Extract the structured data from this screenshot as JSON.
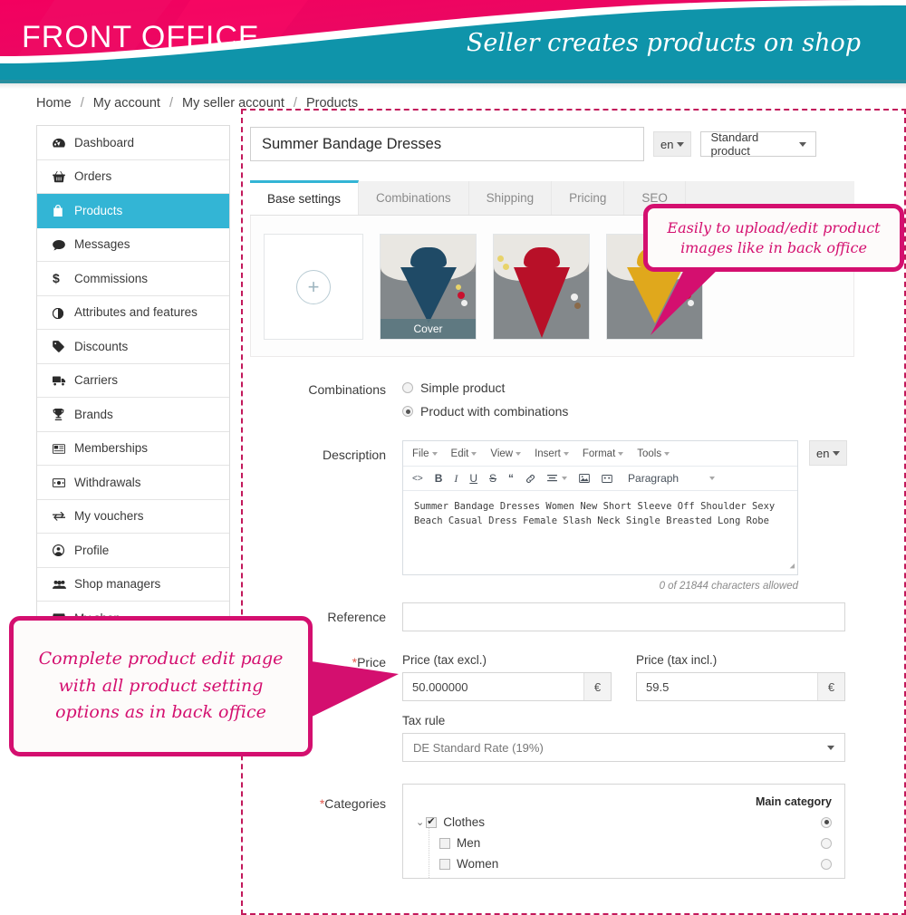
{
  "banner": {
    "left_title": "FRONT OFFICE",
    "right_title": "Seller creates products on shop",
    "pink": "#ec0a63",
    "teal": "#0f94aa"
  },
  "breadcrumb": {
    "items": [
      "Home",
      "My account",
      "My seller account",
      "Products"
    ],
    "separator": "/"
  },
  "sidebar": {
    "items": [
      {
        "label": "Dashboard",
        "icon": "dashboard-icon",
        "active": false
      },
      {
        "label": "Orders",
        "icon": "basket-icon",
        "active": false
      },
      {
        "label": "Products",
        "icon": "shopping-bag-icon",
        "active": true
      },
      {
        "label": "Messages",
        "icon": "comment-icon",
        "active": false
      },
      {
        "label": "Commissions",
        "icon": "dollar-icon",
        "active": false
      },
      {
        "label": "Attributes and features",
        "icon": "contrast-icon",
        "active": false
      },
      {
        "label": "Discounts",
        "icon": "tag-icon",
        "active": false
      },
      {
        "label": "Carriers",
        "icon": "truck-icon",
        "active": false
      },
      {
        "label": "Brands",
        "icon": "trophy-icon",
        "active": false
      },
      {
        "label": "Memberships",
        "icon": "id-card-icon",
        "active": false
      },
      {
        "label": "Withdrawals",
        "icon": "money-icon",
        "active": false
      },
      {
        "label": "My vouchers",
        "icon": "exchange-icon",
        "active": false
      },
      {
        "label": "Profile",
        "icon": "user-circle-icon",
        "active": false
      },
      {
        "label": "Shop managers",
        "icon": "users-icon",
        "active": false
      },
      {
        "label": "My shop",
        "icon": "store-icon",
        "active": false
      }
    ]
  },
  "product": {
    "name_value": "Summer Bandage Dresses",
    "lang_button": "en",
    "type_select": "Standard product"
  },
  "tabs": [
    {
      "label": "Base settings",
      "active": true
    },
    {
      "label": "Combinations",
      "active": false
    },
    {
      "label": "Shipping",
      "active": false
    },
    {
      "label": "Pricing",
      "active": false
    },
    {
      "label": "SEO",
      "active": false
    }
  ],
  "images": {
    "add_label": "+",
    "thumbs": [
      {
        "color": "#1f4a66",
        "cover": true,
        "cover_label": "Cover"
      },
      {
        "color": "#b81028",
        "cover": false,
        "cover_label": ""
      },
      {
        "color": "#e0a81c",
        "cover": false,
        "cover_label": ""
      }
    ]
  },
  "combinations": {
    "label": "Combinations",
    "options": [
      {
        "label": "Simple product",
        "checked": false
      },
      {
        "label": "Product with combinations",
        "checked": true
      }
    ]
  },
  "description": {
    "label": "Description",
    "lang_button": "en",
    "menu": [
      "File",
      "Edit",
      "View",
      "Insert",
      "Format",
      "Tools"
    ],
    "toolbar_icons": [
      "code-icon",
      "bold-icon",
      "italic-icon",
      "underline-icon",
      "strikethrough-icon",
      "blockquote-icon",
      "link-icon",
      "align-icon",
      "image-icon",
      "media-icon"
    ],
    "format_select": "Paragraph",
    "body_text": "Summer Bandage Dresses Women New Short Sleeve Off Shoulder Sexy Beach Casual Dress Female Slash Neck Single Breasted Long Robe",
    "char_count": "0 of 21844 characters allowed"
  },
  "reference": {
    "label": "Reference",
    "value": ""
  },
  "price": {
    "label": "Price",
    "required": "*",
    "tax_excl_caption": "Price (tax excl.)",
    "tax_excl_value": "50.000000",
    "tax_incl_caption": "Price (tax incl.)",
    "tax_incl_value": "59.5",
    "currency": "€",
    "tax_rule_caption": "Tax rule",
    "tax_rule_value": "DE Standard Rate (19%)"
  },
  "categories": {
    "label": "Categories",
    "required": "*",
    "main_category_header": "Main category",
    "rows": [
      {
        "label": "Clothes",
        "checked": true,
        "main": true,
        "level": 0
      },
      {
        "label": "Men",
        "checked": false,
        "main": false,
        "level": 1
      },
      {
        "label": "Women",
        "checked": false,
        "main": false,
        "level": 1
      }
    ]
  },
  "callouts": {
    "top": "Easily to upload/edit product images like in back office",
    "bottom": "Complete product edit page with all product setting options as in back office",
    "color": "#d40f6f"
  }
}
